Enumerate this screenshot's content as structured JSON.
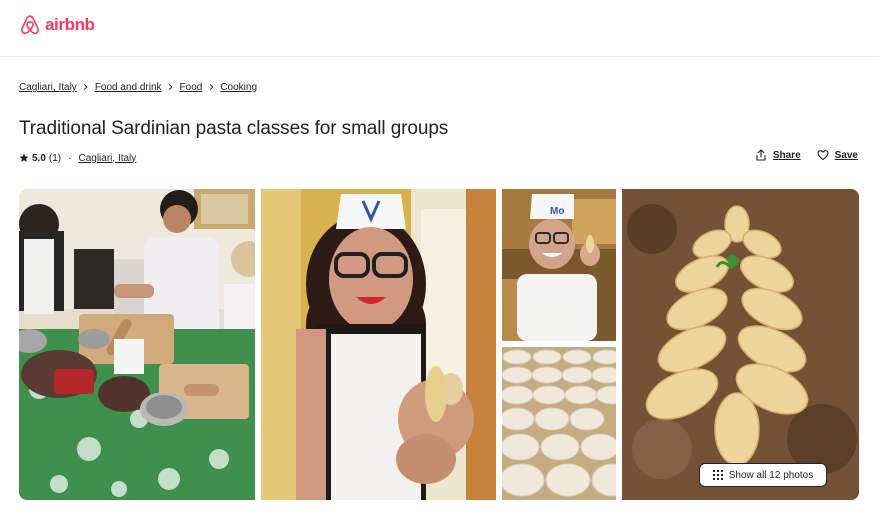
{
  "brand": {
    "name": "airbnb",
    "color": "#ff385c"
  },
  "breadcrumb": [
    {
      "label": "Cagliari, Italy"
    },
    {
      "label": "Food and drink"
    },
    {
      "label": "Food"
    },
    {
      "label": "Cooking"
    }
  ],
  "listing": {
    "title": "Traditional Sardinian pasta classes for small groups",
    "rating": "5.0",
    "reviews": "(1)",
    "separator": "·",
    "location": "Cagliari, Italy"
  },
  "actions": {
    "share_label": "Share",
    "save_label": "Save"
  },
  "gallery": {
    "photos": [
      {
        "icon": "photo-pasta-class-table"
      },
      {
        "icon": "photo-chef-holding-pasta"
      },
      {
        "icon": "photo-chef-smiling"
      },
      {
        "icon": "photo-culurgiones-rows"
      },
      {
        "icon": "photo-culurgiones-arrangement"
      }
    ],
    "show_all_label": "Show all 12 photos"
  },
  "colors": {
    "text": "#222222",
    "divider": "#ebebeb",
    "accent": "#ff385c"
  }
}
